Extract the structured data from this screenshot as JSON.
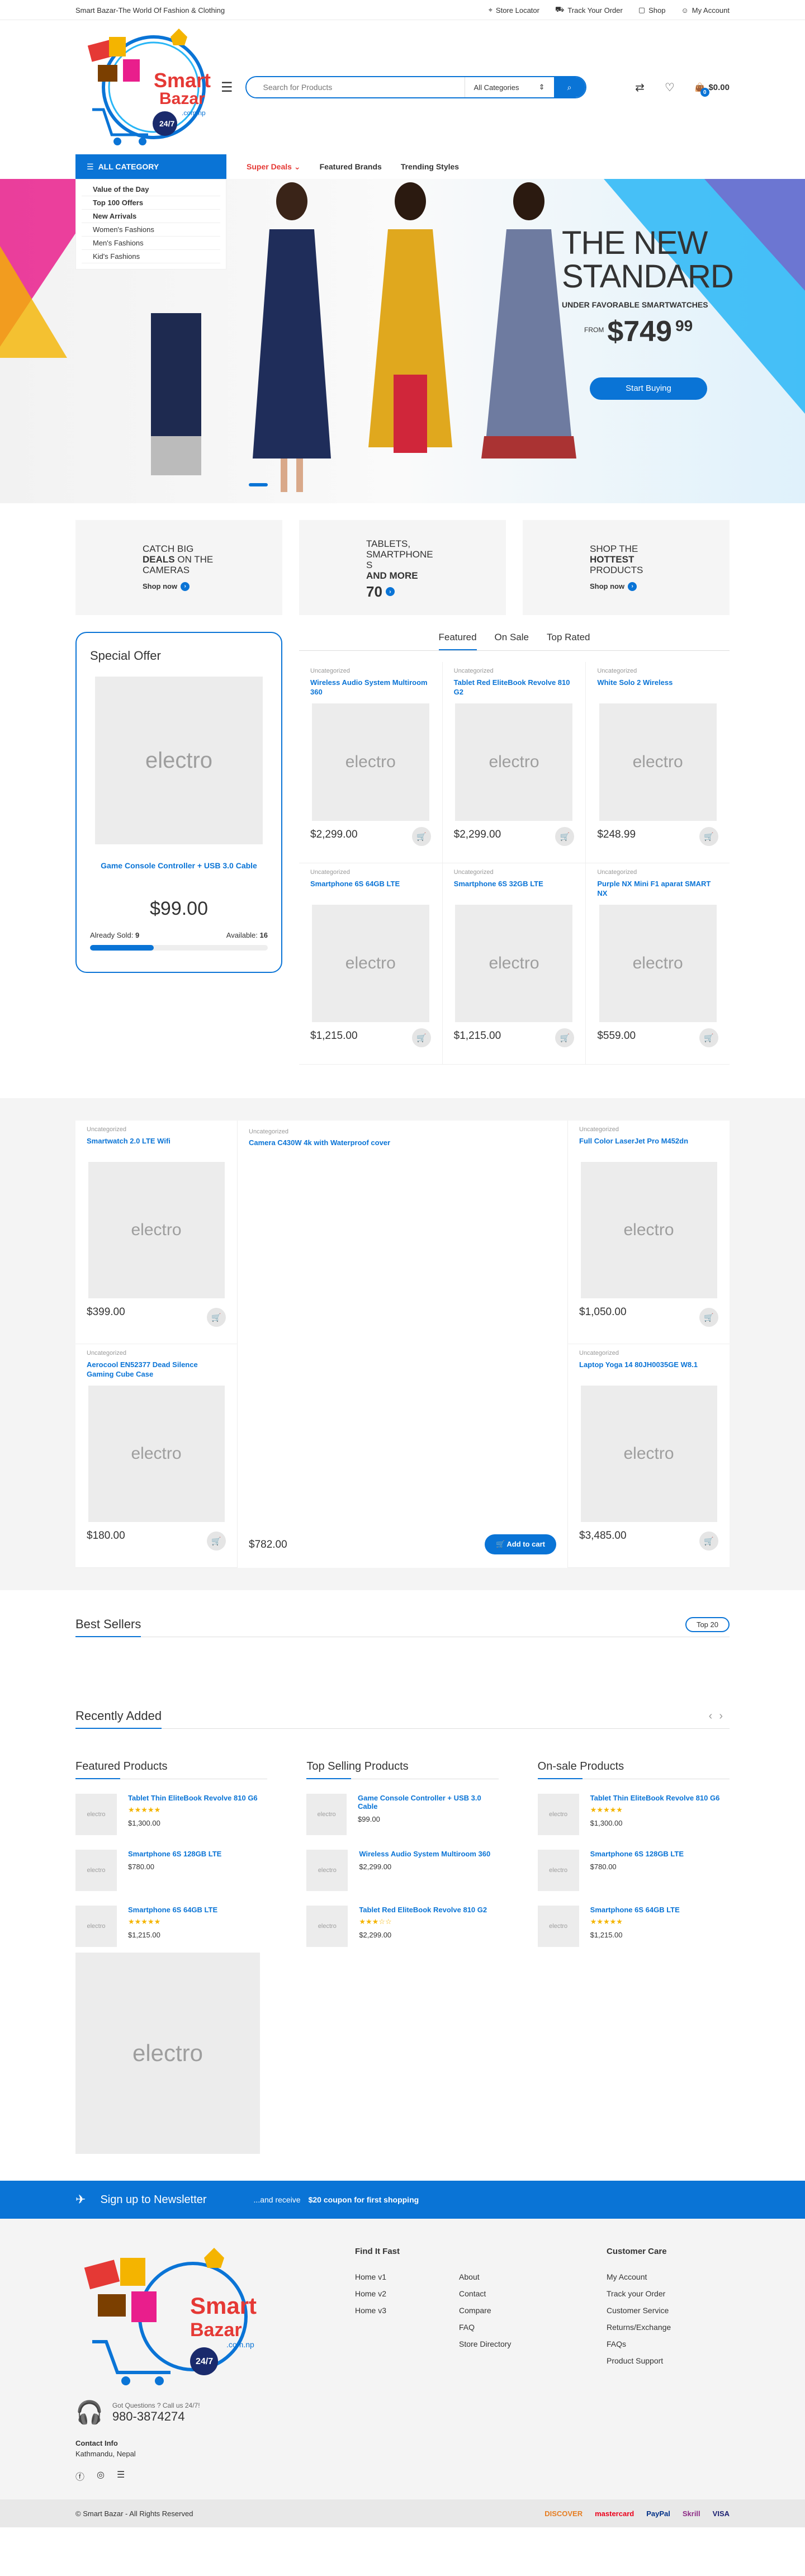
{
  "topbar": {
    "tagline": "Smart Bazar-The World Of Fashion & Clothing",
    "links": [
      "Store Locator",
      "Track Your Order",
      "Shop",
      "My Account"
    ]
  },
  "logo": {
    "line1": "Smart",
    "line2": "Bazar",
    "suffix": ".com.np",
    "badge": "24/7"
  },
  "search": {
    "placeholder": "Search for Products",
    "category": "All Categories"
  },
  "cart": {
    "amount": "$0.00",
    "count": "0"
  },
  "nav": {
    "all_category": "ALL CATEGORY",
    "links": [
      "Super Deals",
      "Featured Brands",
      "Trending Styles"
    ]
  },
  "category_menu": [
    "Value of the Day",
    "Top 100 Offers",
    "New Arrivals",
    "Women's Fashions",
    "Men's Fashions",
    "Kid's Fashions"
  ],
  "hero": {
    "title1": "THE NEW",
    "title2": "STANDARD",
    "subtitle": "UNDER FAVORABLE SMARTWATCHES",
    "from": "FROM",
    "price_main": "$749",
    "price_cents": "99",
    "button": "Start Buying"
  },
  "banners": [
    {
      "l1": "CATCH BIG",
      "l2": "DEALS",
      "l2b": "ON THE",
      "l3": "CAMERAS",
      "link": "Shop now"
    },
    {
      "l1": "TABLETS,",
      "l2": "SMARTPHONE",
      "l2b": "S",
      "l3": "AND MORE",
      "link": "70"
    },
    {
      "l1": "SHOP THE",
      "l2": "HOTTEST",
      "l2b": "",
      "l3": "PRODUCTS",
      "link": "Shop now"
    }
  ],
  "special": {
    "title": "Special Offer",
    "name": "Game Console Controller + USB 3.0 Cable",
    "price": "$99.00",
    "sold_label": "Already Sold:",
    "sold": "9",
    "avail_label": "Available:",
    "avail": "16",
    "progress": 0.36,
    "placeholder": "electro"
  },
  "tabs": [
    "Featured",
    "On Sale",
    "Top Rated"
  ],
  "products": [
    {
      "c": "Uncategorized",
      "n": "Wireless Audio System Multiroom 360",
      "p": "$2,299.00"
    },
    {
      "c": "Uncategorized",
      "n": "Tablet Red EliteBook Revolve 810 G2",
      "p": "$2,299.00"
    },
    {
      "c": "Uncategorized",
      "n": "White Solo 2 Wireless",
      "p": "$248.99"
    },
    {
      "c": "Uncategorized",
      "n": "Smartphone 6S 64GB LTE",
      "p": "$1,215.00"
    },
    {
      "c": "Uncategorized",
      "n": "Smartphone 6S 32GB LTE",
      "p": "$1,215.00"
    },
    {
      "c": "Uncategorized",
      "n": "Purple NX Mini F1 aparat SMART NX",
      "p": "$559.00"
    }
  ],
  "band": {
    "left": [
      {
        "c": "Uncategorized",
        "n": "Smartwatch 2.0 LTE Wifi",
        "p": "$399.00"
      },
      {
        "c": "Uncategorized",
        "n": "Aerocool EN52377 Dead Silence Gaming Cube Case",
        "p": "$180.00"
      }
    ],
    "mid": {
      "c": "Uncategorized",
      "n": "Camera C430W 4k with Waterproof cover",
      "p": "$782.00",
      "btn": "Add to cart"
    },
    "right": [
      {
        "c": "Uncategorized",
        "n": "Full Color LaserJet Pro M452dn",
        "p": "$1,050.00"
      },
      {
        "c": "Uncategorized",
        "n": "Laptop Yoga 14 80JH0035GE W8.1",
        "p": "$3,485.00"
      }
    ]
  },
  "best_sellers": {
    "title": "Best Sellers",
    "btn": "Top 20"
  },
  "recent": {
    "title": "Recently Added"
  },
  "lists": [
    {
      "title": "Featured Products",
      "items": [
        {
          "n": "Tablet Thin EliteBook Revolve 810 G6",
          "p": "$1,300.00",
          "r": "★★★★★"
        },
        {
          "n": "Smartphone 6S 128GB LTE",
          "p": "$780.00",
          "r": ""
        },
        {
          "n": "Smartphone 6S 64GB LTE",
          "p": "$1,215.00",
          "r": "★★★★★"
        }
      ]
    },
    {
      "title": "Top Selling Products",
      "items": [
        {
          "n": "Game Console Controller + USB 3.0 Cable",
          "p": "$99.00",
          "r": ""
        },
        {
          "n": "Wireless Audio System Multiroom 360",
          "p": "$2,299.00",
          "r": ""
        },
        {
          "n": "Tablet Red EliteBook Revolve 810 G2",
          "p": "$2,299.00",
          "r": "★★★☆☆"
        }
      ]
    },
    {
      "title": "On-sale Products",
      "items": [
        {
          "n": "Tablet Thin EliteBook Revolve 810 G6",
          "p": "$1,300.00",
          "r": "★★★★★"
        },
        {
          "n": "Smartphone 6S 128GB LTE",
          "p": "$780.00",
          "r": ""
        },
        {
          "n": "Smartphone 6S 64GB LTE",
          "p": "$1,215.00",
          "r": "★★★★★"
        }
      ]
    }
  ],
  "newsletter": {
    "title": "Sign up to Newsletter",
    "text1": "...and receive",
    "text2": "$20 coupon for first shopping"
  },
  "footer": {
    "find": "Find It Fast",
    "col1": [
      "Home v1",
      "Home v2",
      "Home v3"
    ],
    "col2": [
      "About",
      "Contact",
      "Compare",
      "FAQ",
      "Store Directory"
    ],
    "care": "Customer Care",
    "col3": [
      "My Account",
      "Track your Order",
      "Customer Service",
      "Returns/Exchange",
      "FAQs",
      "Product Support"
    ],
    "q": "Got Questions ? Call us 24/7!",
    "phone": "980-3874274",
    "contact": "Contact Info",
    "addr": "Kathmandu, Nepal"
  },
  "copyright": "© Smart Bazar - All Rights Reserved",
  "payments": [
    "DISCOVER",
    "mastercard",
    "PayPal",
    "Skrill",
    "VISA"
  ],
  "colors": {
    "primary": "#0a74d6",
    "deal": "#e53935",
    "star": "#f4b400"
  }
}
